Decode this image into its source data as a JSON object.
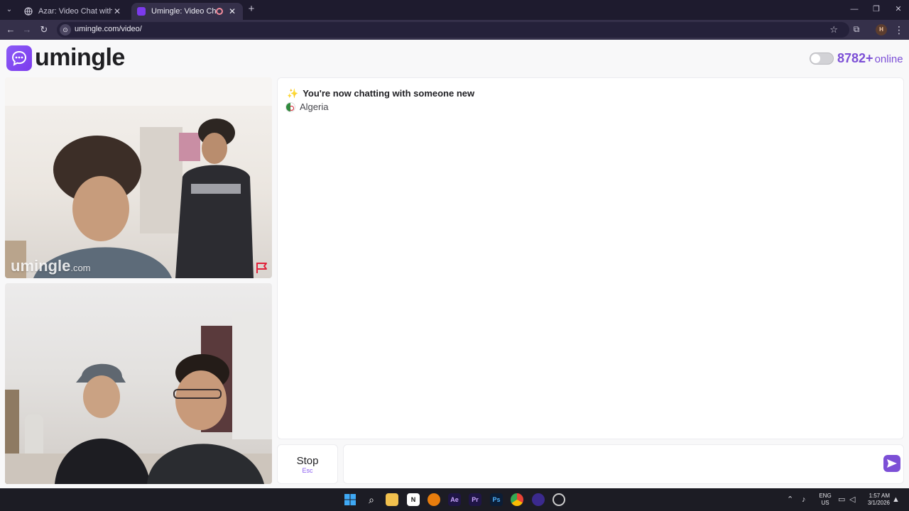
{
  "browser": {
    "tabs": [
      {
        "title": "Azar: Video Chat with New Peo",
        "active": false
      },
      {
        "title": "Umingle: Video Chat with S",
        "active": true,
        "recording": true
      }
    ],
    "url": "umingle.com/video/",
    "profile_initial": "H"
  },
  "header": {
    "logo_text": "umingle",
    "online_count": "8782+",
    "online_label": "online",
    "toggle_on": false
  },
  "cams": {
    "watermark": "umingle",
    "watermark_suffix": ".com"
  },
  "chat": {
    "sparkle": "✨",
    "system_message": "You're now chatting with someone new",
    "country": "Algeria"
  },
  "controls": {
    "stop_label": "Stop",
    "stop_hint": "Esc",
    "input_value": "",
    "input_placeholder": ""
  },
  "taskbar": {
    "lang_line1": "ENG",
    "lang_line2": "US",
    "time": "1:57 AM",
    "date": "3/1/2026"
  },
  "colors": {
    "brand": "#7c3aed",
    "accent": "#7c4fd6",
    "chrome_dark": "#1e1b2e",
    "chrome_toolbar": "#35304a"
  }
}
